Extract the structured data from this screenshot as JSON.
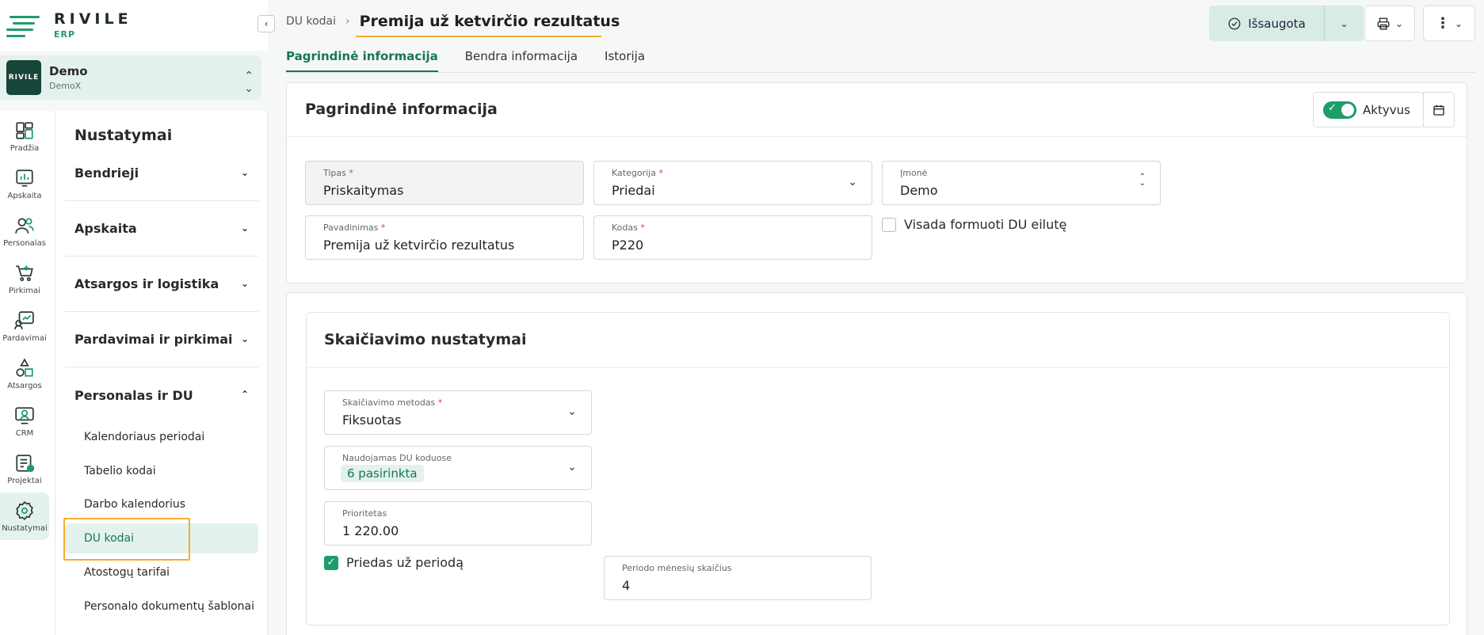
{
  "brand": {
    "name": "RIVILE",
    "sub": "ERP"
  },
  "company": {
    "thumb": "RIVILE",
    "name": "Demo",
    "sub": "DemoX"
  },
  "rail": [
    {
      "label": "Pradžia",
      "icon": "dashboard-icon"
    },
    {
      "label": "Apskaita",
      "icon": "chart-icon"
    },
    {
      "label": "Personalas",
      "icon": "people-icon"
    },
    {
      "label": "Pirkimai",
      "icon": "cart-icon"
    },
    {
      "label": "Pardavimai",
      "icon": "sales-icon"
    },
    {
      "label": "Atsargos",
      "icon": "shapes-icon"
    },
    {
      "label": "CRM",
      "icon": "crm-icon"
    },
    {
      "label": "Projektai",
      "icon": "project-icon"
    },
    {
      "label": "Nustatymai",
      "icon": "gear-icon"
    }
  ],
  "submenu": {
    "title": "Nustatymai",
    "sections": [
      "Bendrieji",
      "Apskaita",
      "Atsargos ir logistika",
      "Pardavimai ir pirkimai",
      "Personalas ir DU"
    ],
    "items": [
      "Kalendoriaus periodai",
      "Tabelio kodai",
      "Darbo kalendorius",
      "DU kodai",
      "Atostogų tarifai",
      "Personalo dokumentų šablonai"
    ]
  },
  "header": {
    "breadcrumb_parent": "DU kodai",
    "title": "Premija už ketvirčio rezultatus",
    "save_label": "Išsaugota"
  },
  "tabs": [
    "Pagrindinė informacija",
    "Bendra informacija",
    "Istorija"
  ],
  "main_card": {
    "title": "Pagrindinė informacija",
    "active_label": "Aktyvus",
    "fields": {
      "tipas": {
        "label": "Tipas",
        "value": "Priskaitymas"
      },
      "kategorija": {
        "label": "Kategorija",
        "value": "Priedai"
      },
      "imone": {
        "label": "Įmonė",
        "value": "Demo"
      },
      "pavadinimas": {
        "label": "Pavadinimas",
        "value": "Premija už ketvirčio rezultatus"
      },
      "kodas": {
        "label": "Kodas",
        "value": "P220"
      }
    },
    "always_line_label": "Visada formuoti DU eilutę"
  },
  "calc_card": {
    "title": "Skaičiavimo nustatymai",
    "method": {
      "label": "Skaičiavimo metodas",
      "value": "Fiksuotas"
    },
    "used_in": {
      "label": "Naudojamas DU koduose",
      "value": "6 pasirinkta"
    },
    "priority": {
      "label": "Prioritetas",
      "value": "1 220.00"
    },
    "period_bonus_label": "Priedas už periodą",
    "months": {
      "label": "Periodo mėnesių skaičius",
      "value": "4"
    }
  },
  "required_mark": "*"
}
